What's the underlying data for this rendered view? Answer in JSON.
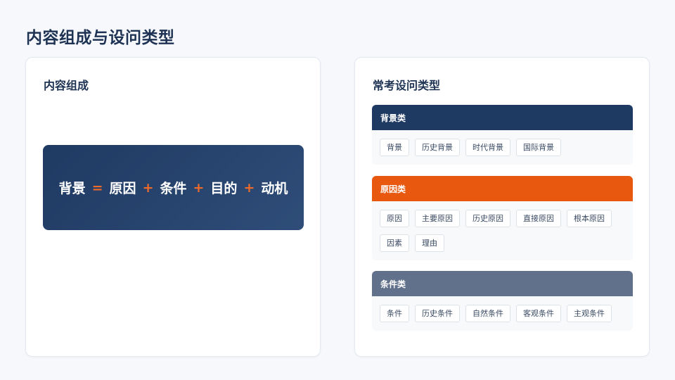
{
  "page": {
    "title": "内容组成与设问类型"
  },
  "left_card": {
    "title": "内容组成",
    "formula": {
      "terms": [
        "背景",
        "原因",
        "条件",
        "目的",
        "动机"
      ],
      "ops": [
        "=",
        "+",
        "+",
        "+"
      ]
    }
  },
  "right_card": {
    "title": "常考设问类型",
    "groups": [
      {
        "label": "背景类",
        "color": "#1e3a63",
        "tags": [
          "背景",
          "历史背景",
          "时代背景",
          "国际背景"
        ]
      },
      {
        "label": "原因类",
        "color": "#e8590f",
        "tags": [
          "原因",
          "主要原因",
          "历史原因",
          "直接原因",
          "根本原因",
          "因素",
          "理由"
        ]
      },
      {
        "label": "条件类",
        "color": "#62718b",
        "tags": [
          "条件",
          "历史条件",
          "自然条件",
          "客观条件",
          "主观条件"
        ]
      }
    ]
  }
}
